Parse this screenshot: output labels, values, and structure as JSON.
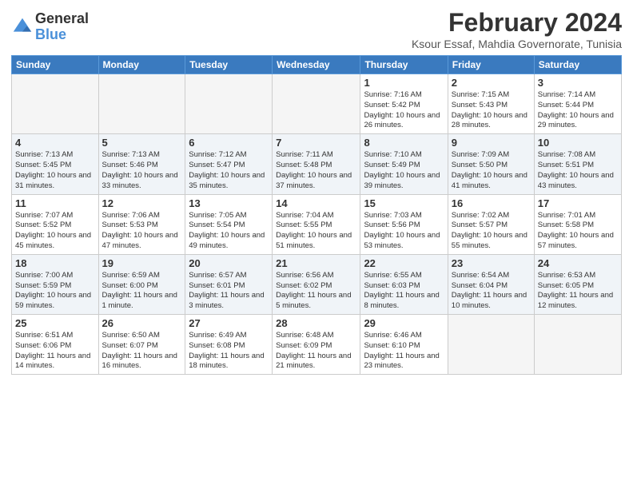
{
  "logo": {
    "line1": "General",
    "line2": "Blue"
  },
  "title": "February 2024",
  "subtitle": "Ksour Essaf, Mahdia Governorate, Tunisia",
  "headers": [
    "Sunday",
    "Monday",
    "Tuesday",
    "Wednesday",
    "Thursday",
    "Friday",
    "Saturday"
  ],
  "weeks": [
    {
      "shade": false,
      "days": [
        {
          "num": "",
          "info": ""
        },
        {
          "num": "",
          "info": ""
        },
        {
          "num": "",
          "info": ""
        },
        {
          "num": "",
          "info": ""
        },
        {
          "num": "1",
          "info": "Sunrise: 7:16 AM\nSunset: 5:42 PM\nDaylight: 10 hours\nand 26 minutes."
        },
        {
          "num": "2",
          "info": "Sunrise: 7:15 AM\nSunset: 5:43 PM\nDaylight: 10 hours\nand 28 minutes."
        },
        {
          "num": "3",
          "info": "Sunrise: 7:14 AM\nSunset: 5:44 PM\nDaylight: 10 hours\nand 29 minutes."
        }
      ]
    },
    {
      "shade": true,
      "days": [
        {
          "num": "4",
          "info": "Sunrise: 7:13 AM\nSunset: 5:45 PM\nDaylight: 10 hours\nand 31 minutes."
        },
        {
          "num": "5",
          "info": "Sunrise: 7:13 AM\nSunset: 5:46 PM\nDaylight: 10 hours\nand 33 minutes."
        },
        {
          "num": "6",
          "info": "Sunrise: 7:12 AM\nSunset: 5:47 PM\nDaylight: 10 hours\nand 35 minutes."
        },
        {
          "num": "7",
          "info": "Sunrise: 7:11 AM\nSunset: 5:48 PM\nDaylight: 10 hours\nand 37 minutes."
        },
        {
          "num": "8",
          "info": "Sunrise: 7:10 AM\nSunset: 5:49 PM\nDaylight: 10 hours\nand 39 minutes."
        },
        {
          "num": "9",
          "info": "Sunrise: 7:09 AM\nSunset: 5:50 PM\nDaylight: 10 hours\nand 41 minutes."
        },
        {
          "num": "10",
          "info": "Sunrise: 7:08 AM\nSunset: 5:51 PM\nDaylight: 10 hours\nand 43 minutes."
        }
      ]
    },
    {
      "shade": false,
      "days": [
        {
          "num": "11",
          "info": "Sunrise: 7:07 AM\nSunset: 5:52 PM\nDaylight: 10 hours\nand 45 minutes."
        },
        {
          "num": "12",
          "info": "Sunrise: 7:06 AM\nSunset: 5:53 PM\nDaylight: 10 hours\nand 47 minutes."
        },
        {
          "num": "13",
          "info": "Sunrise: 7:05 AM\nSunset: 5:54 PM\nDaylight: 10 hours\nand 49 minutes."
        },
        {
          "num": "14",
          "info": "Sunrise: 7:04 AM\nSunset: 5:55 PM\nDaylight: 10 hours\nand 51 minutes."
        },
        {
          "num": "15",
          "info": "Sunrise: 7:03 AM\nSunset: 5:56 PM\nDaylight: 10 hours\nand 53 minutes."
        },
        {
          "num": "16",
          "info": "Sunrise: 7:02 AM\nSunset: 5:57 PM\nDaylight: 10 hours\nand 55 minutes."
        },
        {
          "num": "17",
          "info": "Sunrise: 7:01 AM\nSunset: 5:58 PM\nDaylight: 10 hours\nand 57 minutes."
        }
      ]
    },
    {
      "shade": true,
      "days": [
        {
          "num": "18",
          "info": "Sunrise: 7:00 AM\nSunset: 5:59 PM\nDaylight: 10 hours\nand 59 minutes."
        },
        {
          "num": "19",
          "info": "Sunrise: 6:59 AM\nSunset: 6:00 PM\nDaylight: 11 hours\nand 1 minute."
        },
        {
          "num": "20",
          "info": "Sunrise: 6:57 AM\nSunset: 6:01 PM\nDaylight: 11 hours\nand 3 minutes."
        },
        {
          "num": "21",
          "info": "Sunrise: 6:56 AM\nSunset: 6:02 PM\nDaylight: 11 hours\nand 5 minutes."
        },
        {
          "num": "22",
          "info": "Sunrise: 6:55 AM\nSunset: 6:03 PM\nDaylight: 11 hours\nand 8 minutes."
        },
        {
          "num": "23",
          "info": "Sunrise: 6:54 AM\nSunset: 6:04 PM\nDaylight: 11 hours\nand 10 minutes."
        },
        {
          "num": "24",
          "info": "Sunrise: 6:53 AM\nSunset: 6:05 PM\nDaylight: 11 hours\nand 12 minutes."
        }
      ]
    },
    {
      "shade": false,
      "days": [
        {
          "num": "25",
          "info": "Sunrise: 6:51 AM\nSunset: 6:06 PM\nDaylight: 11 hours\nand 14 minutes."
        },
        {
          "num": "26",
          "info": "Sunrise: 6:50 AM\nSunset: 6:07 PM\nDaylight: 11 hours\nand 16 minutes."
        },
        {
          "num": "27",
          "info": "Sunrise: 6:49 AM\nSunset: 6:08 PM\nDaylight: 11 hours\nand 18 minutes."
        },
        {
          "num": "28",
          "info": "Sunrise: 6:48 AM\nSunset: 6:09 PM\nDaylight: 11 hours\nand 21 minutes."
        },
        {
          "num": "29",
          "info": "Sunrise: 6:46 AM\nSunset: 6:10 PM\nDaylight: 11 hours\nand 23 minutes."
        },
        {
          "num": "",
          "info": ""
        },
        {
          "num": "",
          "info": ""
        }
      ]
    }
  ]
}
